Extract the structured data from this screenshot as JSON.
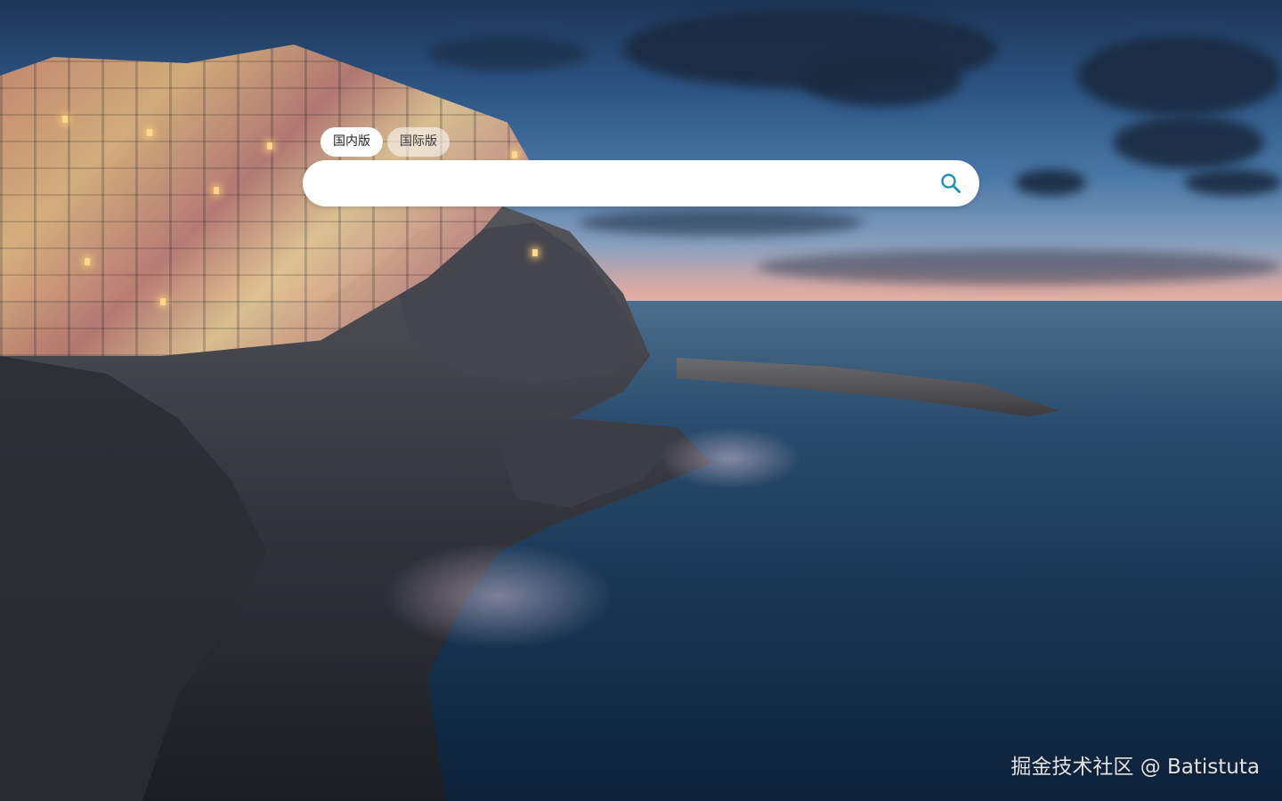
{
  "version_tabs": [
    {
      "label": "国内版",
      "active": true
    },
    {
      "label": "国际版",
      "active": false
    }
  ],
  "search": {
    "value": "",
    "placeholder": "",
    "button_icon": "search-icon"
  },
  "watermark": {
    "text": "掘金技术社区 @ Batistuta"
  },
  "colors": {
    "search_icon": "#1a8fb8",
    "tab_active_bg": "#ffffff",
    "tab_inactive_bg": "rgba(255,255,255,0.55)"
  }
}
